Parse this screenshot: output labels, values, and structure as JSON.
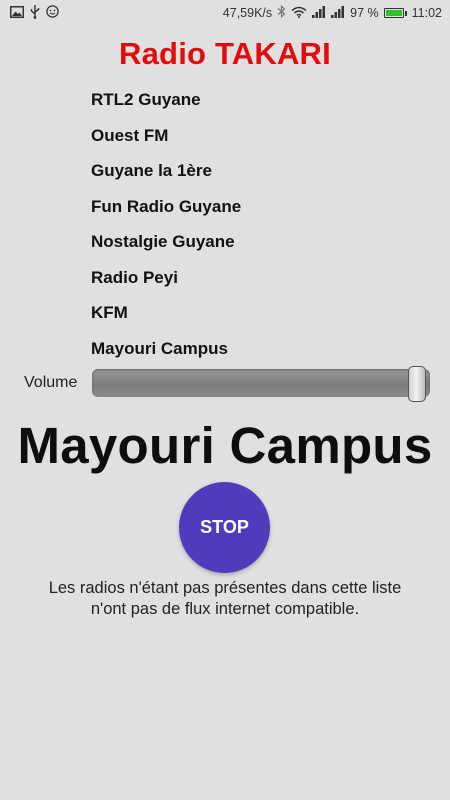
{
  "status_bar": {
    "icons_left": [
      "image-icon",
      "usb-icon",
      "smiley-icon"
    ],
    "network_speed": "47,59K/s",
    "battery_percent": "97 %",
    "battery_level": 0.97,
    "time": "11:02",
    "icons_right": [
      "bluetooth-icon",
      "wifi-icon",
      "signal-icon",
      "signal-icon"
    ]
  },
  "app": {
    "title": "Radio TAKARI",
    "title_color": "#e30b0b"
  },
  "stations": [
    {
      "label": "RTL2 Guyane"
    },
    {
      "label": "Ouest FM"
    },
    {
      "label": "Guyane la 1ère"
    },
    {
      "label": "Fun Radio Guyane"
    },
    {
      "label": "Nostalgie Guyane"
    },
    {
      "label": "Radio Peyi"
    },
    {
      "label": "KFM"
    },
    {
      "label": "Mayouri Campus"
    }
  ],
  "volume": {
    "label": "Volume",
    "level": 1.0
  },
  "now_playing": "Mayouri Campus",
  "stop_button": {
    "label": "STOP",
    "color": "#4f3cbd"
  },
  "notice": {
    "line1": "Les radios n'étant pas présentes dans cette liste",
    "line2": "n'ont pas de flux internet compatible."
  }
}
